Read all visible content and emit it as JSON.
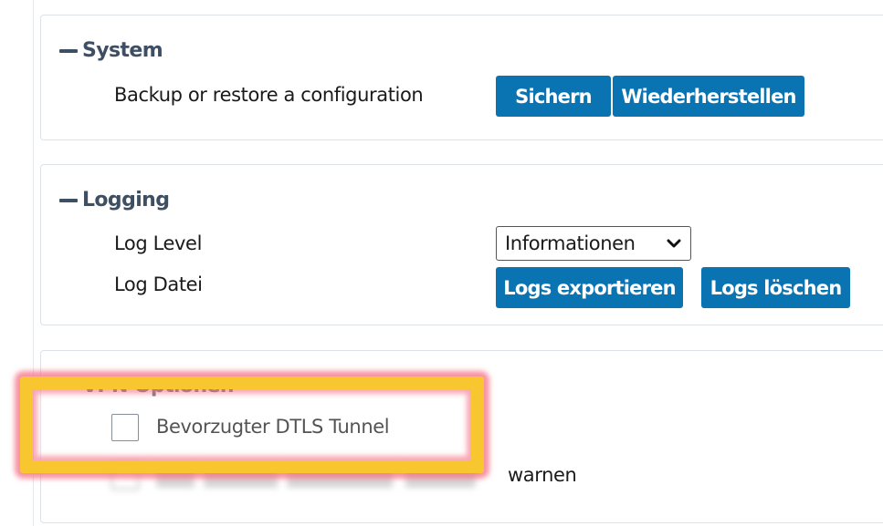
{
  "system": {
    "title": "System",
    "row_label": "Backup or restore a configuration",
    "save_label": "Sichern",
    "restore_label": "Wiederherstellen"
  },
  "logging": {
    "title": "Logging",
    "level_label": "Log Level",
    "level_value": "Informationen",
    "file_label": "Log Datei",
    "export_label": "Logs exportieren",
    "delete_label": "Logs löschen"
  },
  "vpn": {
    "title": "VPN Optionen",
    "prefer_dtls_label": "Bevorzugter DTLS Tunnel",
    "cert_warning_label_visible_part": "warnen"
  },
  "colors": {
    "accent": "#0a74b3",
    "section_title": "#3e4f63",
    "highlight_border": "#f8c62e",
    "highlight_glow": "#f56e82"
  }
}
